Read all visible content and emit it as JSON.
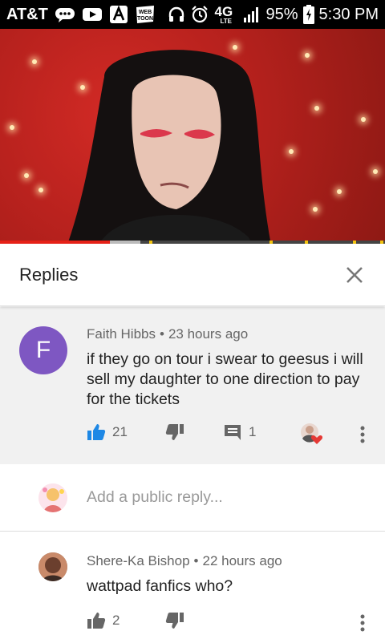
{
  "status_bar": {
    "carrier": "AT&T",
    "network": "4G",
    "network_sub": "LTE",
    "battery": "95%",
    "time": "5:30 PM",
    "icons": [
      "message-icon",
      "youtube-icon",
      "a-app-icon",
      "webtoon-icon",
      "headphones-icon",
      "alarm-icon",
      "signal-icon",
      "battery-icon"
    ],
    "webtoon_label": "WEB TOON"
  },
  "video": {
    "progress_played": 0.285,
    "buffer_segment": [
      0.285,
      0.365
    ]
  },
  "replies_panel": {
    "title": "Replies",
    "close_icon": "close-icon"
  },
  "main_comment": {
    "avatar_letter": "F",
    "avatar_color": "#7e57c2",
    "author": "Faith Hibbs",
    "separator": "•",
    "time": "23 hours ago",
    "text": "if they go on tour i swear to geesus i will sell my daughter to one direction to pay for the tickets",
    "likes": "21",
    "replies": "1",
    "liked": true,
    "like_color": "#1e88e5"
  },
  "add_reply": {
    "placeholder": "Add a public reply..."
  },
  "reply_comment": {
    "author": "Shere-Ka Bishop",
    "separator": "•",
    "time": "22 hours ago",
    "text": "wattpad fanfics who?",
    "likes": "2"
  }
}
